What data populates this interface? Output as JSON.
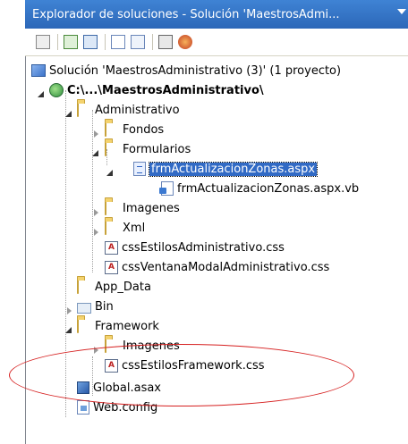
{
  "titlebar": {
    "title": "Explorador de soluciones - Solución 'MaestrosAdmi..."
  },
  "toolbar": {
    "buttons": [
      "properties-icon",
      "refresh-icon",
      "show-all-files-icon",
      "view-code-icon",
      "view-designer-icon",
      "nest-related-icon",
      "copy-website-icon"
    ]
  },
  "tree": {
    "solution": "Solución 'MaestrosAdministrativo (3)'  (1 proyecto)",
    "project": "C:\\...\\MaestrosAdministrativo\\",
    "administrativo": "Administrativo",
    "fondos": "Fondos",
    "formularios": "Formularios",
    "frm_aspx": "frmActualizacionZonas.aspx",
    "frm_vb": "frmActualizacionZonas.aspx.vb",
    "imagenes1": "Imagenes",
    "xml": "Xml",
    "css_admin": "cssEstilosAdministrativo.css",
    "css_modal": "cssVentanaModalAdministrativo.css",
    "app_data": "App_Data",
    "bin": "Bin",
    "framework": "Framework",
    "imagenes2": "Imagenes",
    "css_framework": "cssEstilosFramework.css",
    "global": "Global.asax",
    "webconfig": "Web.config"
  },
  "colors": {
    "title_bar": "#3f83d4",
    "selection": "#316ac5",
    "annotation": "#d62020"
  }
}
